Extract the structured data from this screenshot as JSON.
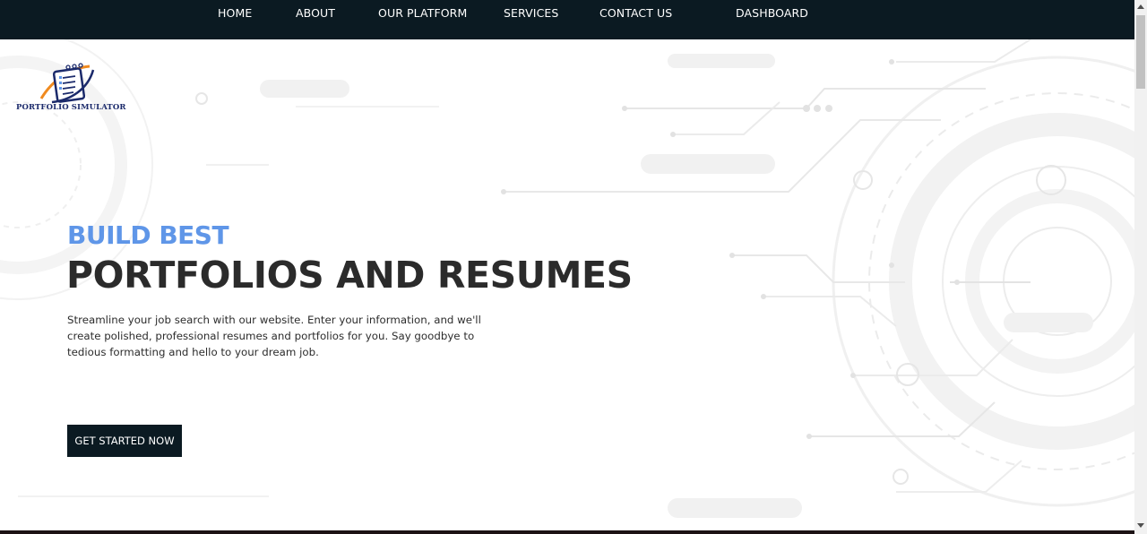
{
  "nav": {
    "items": [
      {
        "label": "HOME"
      },
      {
        "label": "ABOUT"
      },
      {
        "label": "OUR PLATFORM"
      },
      {
        "label": "SERVICES"
      },
      {
        "label": "CONTACT US"
      },
      {
        "label": "DASHBOARD"
      }
    ]
  },
  "logo": {
    "text": "PORTFOLIO SIMULATOR",
    "icon": "resume-document-icon"
  },
  "hero": {
    "eyebrow": "BUILD BEST",
    "headline": "PORTFOLIOS AND RESUMES",
    "description": "Streamline your job search with our website. Enter your information, and we'll create polished, professional resumes and portfolios for you. Say goodbye to tedious formatting and hello to your dream job.",
    "cta_label": "GET STARTED NOW"
  },
  "colors": {
    "nav_background": "#0b1a22",
    "accent_blue": "#5f96e8",
    "headline": "#2b2b2b",
    "cta_background": "#0b1a22"
  }
}
